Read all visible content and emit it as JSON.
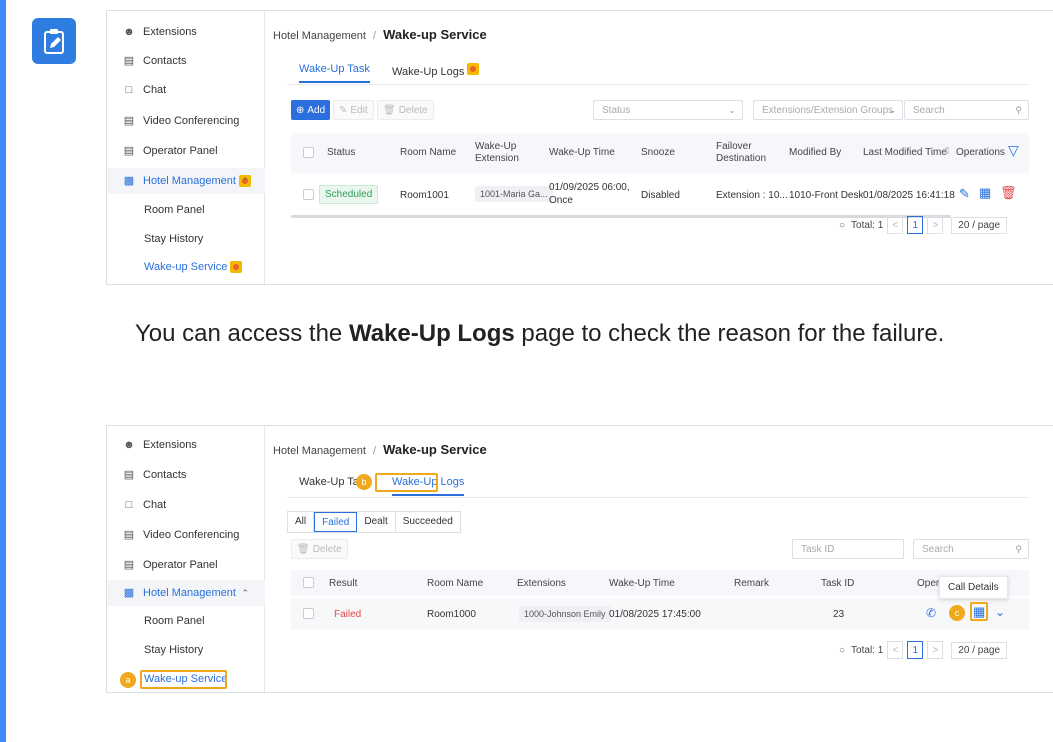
{
  "accent": "#2a6fdb",
  "note_icon": "pencil-edit-icon",
  "paragraph": {
    "before": "You can access the ",
    "bold": "Wake-Up Logs",
    "after": " page to check the reason for the failure."
  },
  "sidebar1": {
    "items": [
      {
        "label": "Extensions",
        "icon": "extensions-icon"
      },
      {
        "label": "Contacts",
        "icon": "contacts-icon"
      },
      {
        "label": "Chat",
        "icon": "chat-icon"
      },
      {
        "label": "Video Conferencing",
        "icon": "video-icon"
      },
      {
        "label": "Operator Panel",
        "icon": "operator-icon"
      },
      {
        "label": "Hotel Management",
        "icon": "hotel-icon"
      },
      {
        "label": "Room Panel"
      },
      {
        "label": "Stay History"
      },
      {
        "label": "Wake-up Service"
      }
    ]
  },
  "screen1": {
    "breadcrumb_parent": "Hotel Management",
    "breadcrumb_sep": "/",
    "breadcrumb_current": "Wake-up Service",
    "tabs": [
      "Wake-Up Task",
      "Wake-Up Logs"
    ],
    "toolbar": {
      "add": "Add",
      "edit": "Edit",
      "delete": "Delete"
    },
    "filters": {
      "status": "Status",
      "ext_groups": "Extensions/Extension Groups",
      "search": "Search"
    },
    "columns": [
      "Status",
      "Room Name",
      "Wake-Up Extension",
      "Wake-Up Time",
      "Snooze",
      "Failover Destination",
      "Modified By",
      "Last Modified Time",
      "Operations"
    ],
    "row": {
      "status": "Scheduled",
      "room": "Room1001",
      "extension": "1001-Maria Ga...",
      "time_line1": "01/09/2025 06:00,",
      "time_line2": "Once",
      "snooze": "Disabled",
      "failover": "Extension : 10...",
      "modified_by": "1010-Front Desk",
      "modified_time": "01/08/2025 16:41:18"
    },
    "pager": {
      "total": "Total: 1",
      "page": "1",
      "per_page": "20 / page"
    }
  },
  "screen2": {
    "breadcrumb_parent": "Hotel Management",
    "breadcrumb_sep": "/",
    "breadcrumb_current": "Wake-up Service",
    "tabs": [
      "Wake-Up Task",
      "Wake-Up Logs"
    ],
    "filter_tabs": [
      "All",
      "Failed",
      "Dealt",
      "Succeeded"
    ],
    "toolbar": {
      "delete": "Delete"
    },
    "filters": {
      "task_id": "Task ID",
      "search": "Search"
    },
    "columns": [
      "Result",
      "Room Name",
      "Extensions",
      "Wake-Up Time",
      "Remark",
      "Task ID",
      "Opera"
    ],
    "row": {
      "result": "Failed",
      "room": "Room1000",
      "extension": "1000-Johnson Emily",
      "time": "01/08/2025 17:45:00",
      "task_id": "23"
    },
    "tooltip": "Call Details",
    "callouts": [
      "a",
      "b",
      "c"
    ],
    "pager": {
      "total": "Total: 1",
      "page": "1",
      "per_page": "20 / page"
    }
  }
}
